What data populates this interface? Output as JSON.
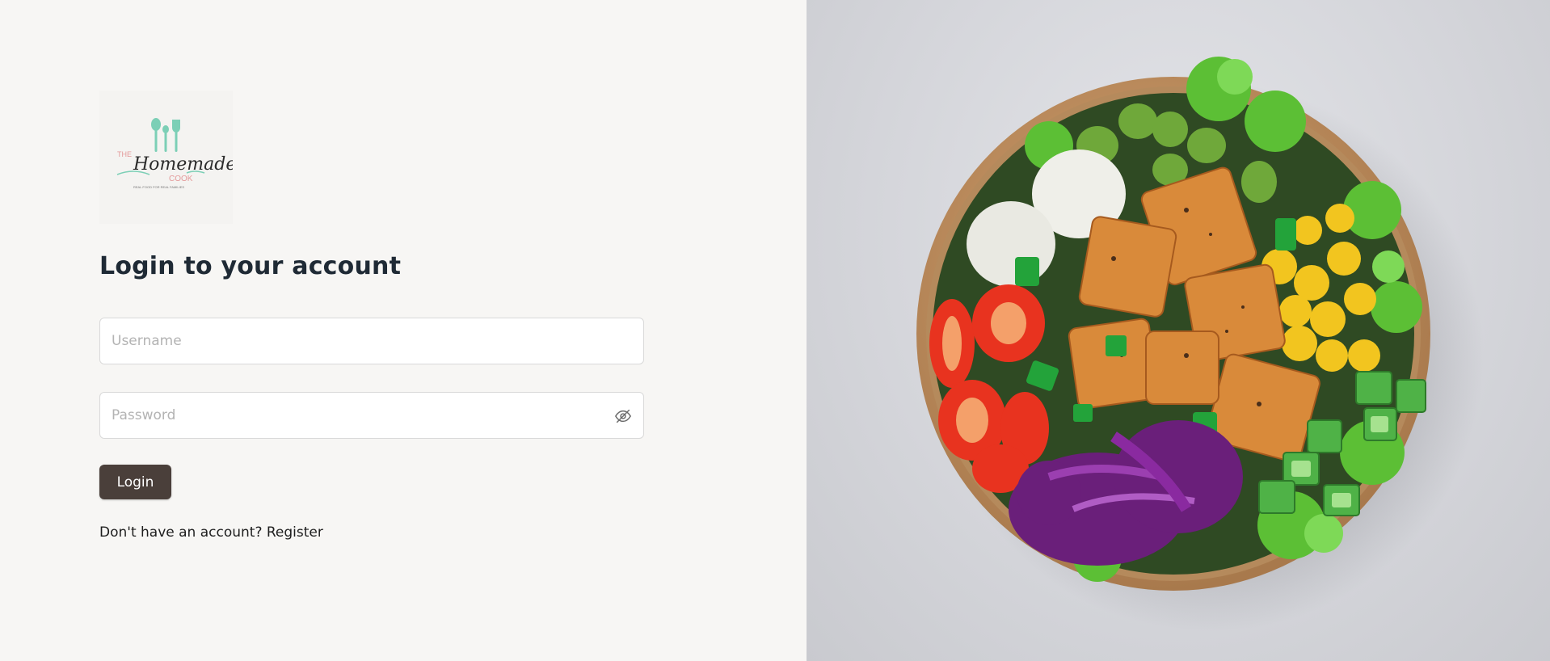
{
  "brand": {
    "logo_top": "THE",
    "logo_main": "Homemade",
    "logo_sub": "COOK",
    "logo_tagline": "REAL FOOD FOR REAL FAMILIES",
    "colors": {
      "mint": "#7ccfb6",
      "pink": "#e39a9a",
      "dark": "#2b2b2b"
    }
  },
  "login": {
    "title": "Login to your account",
    "username_placeholder": "Username",
    "password_placeholder": "Password",
    "password_toggle_icon": "eye-slash-icon",
    "submit_label": "Login",
    "register_prompt": "Don't have an account?",
    "register_link": "Register"
  },
  "hero": {
    "image": "salad-bowl-photo"
  },
  "theme": {
    "background_left": "#f7f6f4",
    "button_color": "#4a3f3a",
    "title_color": "#1f2a35"
  }
}
